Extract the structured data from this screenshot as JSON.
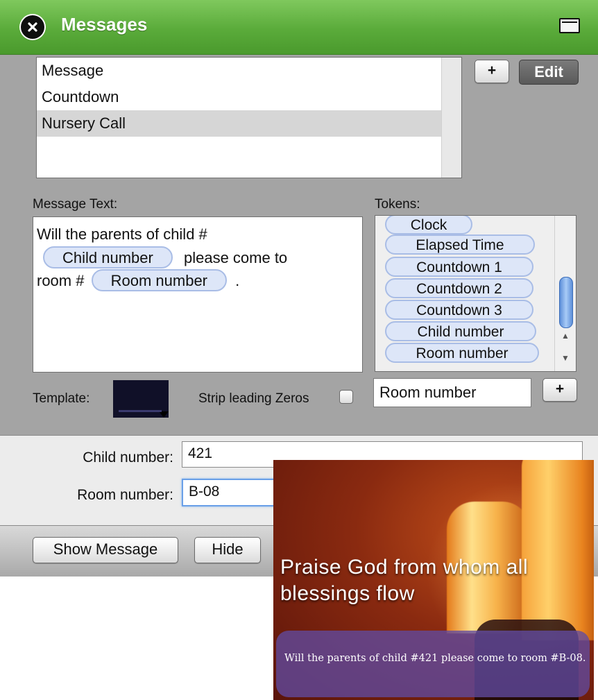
{
  "window": {
    "title": "Messages"
  },
  "message_list": {
    "items": [
      {
        "label": "Message"
      },
      {
        "label": "Countdown"
      },
      {
        "label": "Nursery Call",
        "selected": true
      }
    ],
    "add_label": "+",
    "edit_label": "Edit"
  },
  "message_text": {
    "label": "Message Text:",
    "line1": "Will the parents of child #",
    "token1": "Child number",
    "mid": "please come to",
    "line3_prefix": "room #",
    "token2": "Room number",
    "suffix": "."
  },
  "tokens": {
    "label": "Tokens:",
    "items": [
      "Clock",
      "Elapsed Time",
      "Countdown 1",
      "Countdown 2",
      "Countdown 3",
      "Child number",
      "Room number"
    ],
    "new_token_value": "Room number",
    "add_label": "+"
  },
  "template": {
    "label": "Template:"
  },
  "strip_zeros": {
    "label": "Strip leading Zeros",
    "checked": false
  },
  "fields": [
    {
      "label": "Child number:",
      "value": "421"
    },
    {
      "label": "Room number:",
      "value": "B-08"
    }
  ],
  "buttons": {
    "show_message": "Show Message",
    "hide": "Hide"
  },
  "preview": {
    "headline": "Praise God from whom all blessings flow",
    "message": "Will the parents of child #421 please come to room #B-08."
  },
  "colors": {
    "titlebar_green": "#5aab3a",
    "token_blue": "#dde6f8",
    "overlay_purple": "#604aa0"
  }
}
